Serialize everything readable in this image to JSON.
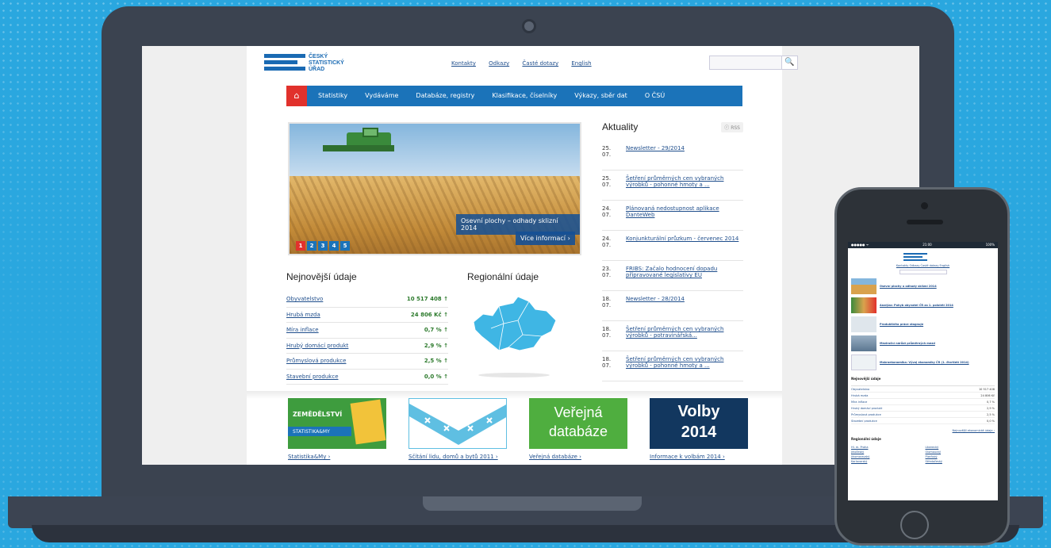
{
  "site": {
    "logo_lines": [
      "ČESKÝ",
      "STATISTICKÝ",
      "ÚŘAD"
    ],
    "top_links": [
      "Kontakty",
      "Odkazy",
      "Časté dotazy",
      "English"
    ],
    "nav": [
      "Statistiky",
      "Vydáváme",
      "Databáze, registry",
      "Klasifikace, číselníky",
      "Výkazy, sběr dat",
      "O ČSÚ"
    ],
    "slider": {
      "caption": "Osevní plochy – odhady sklizní 2014",
      "more": "Více informací ›",
      "pages": [
        "1",
        "2",
        "3",
        "4",
        "5"
      ]
    },
    "latest_title": "Nejnovější údaje",
    "regional_title": "Regionální údaje",
    "stats": [
      {
        "label": "Obyvatelstvo",
        "value": "10 517 408 ↑"
      },
      {
        "label": "Hrubá mzda",
        "value": "24 806 Kč ↑"
      },
      {
        "label": "Míra inflace",
        "value": "0,7 % ↑"
      },
      {
        "label": "Hrubý domácí produkt",
        "value": "2,9 % ↑"
      },
      {
        "label": "Průmyslová produkce",
        "value": "2,5 % ↑"
      },
      {
        "label": "Stavební produkce",
        "value": "0,0 % ↑"
      }
    ],
    "news_title": "Aktuality",
    "rss": "RSS",
    "news": [
      {
        "date": "25. 07.",
        "text": "Newsletter - 29/2014"
      },
      {
        "date": "25. 07.",
        "text": "Šetření průměrných cen vybraných výrobků - pohonné hmoty a ..."
      },
      {
        "date": "24. 07.",
        "text": "Plánovaná nedostupnost aplikace DanteWeb"
      },
      {
        "date": "24. 07.",
        "text": "Konjunkturální průzkum - červenec 2014"
      },
      {
        "date": "23. 07.",
        "text": "FRIBS: Začalo hodnocení dopadu připravované legislativy EU"
      },
      {
        "date": "18. 07.",
        "text": "Newsletter - 28/2014"
      },
      {
        "date": "18. 07.",
        "text": "Šetření průměrných cen vybraných výrobků - potravinářská..."
      },
      {
        "date": "18. 07.",
        "text": "Šetření průměrných cen vybraných výrobků - pohonné hmoty a ..."
      }
    ],
    "banners": [
      {
        "img_text": "ZEMĚDĚLSTVÍ",
        "img_sub": "STATISTIKA&MY",
        "link": "Statistika&My ›"
      },
      {
        "img_text": "",
        "img_sub": "",
        "link": "Sčítání lidu, domů a bytů 2011 ›"
      },
      {
        "img_text": "Veřejná",
        "img_sub": "databáze",
        "link": "Veřejná databáze ›"
      },
      {
        "img_text": "Volby",
        "img_sub": "2014",
        "link": "Informace k volbám 2014 ›"
      }
    ]
  },
  "phone": {
    "status_left": "●●●●● ᯤ",
    "status_time": "21:00",
    "status_right": "100%",
    "links": "Kontakty  Odkazy  Časté dotazy  English",
    "items": [
      "Osevní plochy a odhady sklizní 2014",
      "Analýza: Pohyb obyvatel ČR za 1. pololetí 2014",
      "Produktivita práce stagnuje",
      "Meziroční nárůst průměrných mezd",
      "Makroekonomika: Vývoj ekonomiky ČR (1. čtvrtletí 2014)"
    ],
    "table_title": "Nejnovější údaje",
    "table": [
      {
        "l": "Obyvatelstvo",
        "v": "10 517 408"
      },
      {
        "l": "Hrubá mzda",
        "v": "24 806 Kč"
      },
      {
        "l": "Míra inflace",
        "v": "0,7 %"
      },
      {
        "l": "Hrubý domácí produkt",
        "v": "2,9 %"
      },
      {
        "l": "Průmyslová produkce",
        "v": "2,5 %"
      },
      {
        "l": "Stavební produkce",
        "v": "0,0 %"
      }
    ],
    "more": "Nejnovější ekonomické údaje ›",
    "regional_title": "Regionální údaje",
    "regions": [
      "Hl. m. Praha",
      "Liberecký",
      "Jihočeský",
      "Olomoucký",
      "Jihomoravský",
      "Plzeňský",
      "Karlovarský",
      "Středočeský"
    ]
  },
  "colors": {
    "brand": "#1a6ab3",
    "nav": "#1b73b9",
    "accent": "#e1312c",
    "background": "#2aa7df"
  }
}
